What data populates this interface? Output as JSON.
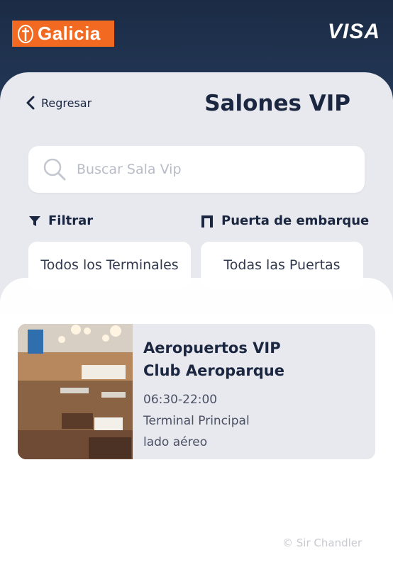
{
  "brand": {
    "bank_name": "Galicia",
    "card_network": "VISA",
    "bank_color": "#f26a21",
    "header_color": "#1b2b45"
  },
  "nav": {
    "back_label": "Regresar",
    "page_title": "Salones VIP"
  },
  "search": {
    "placeholder": "Buscar Sala Vip",
    "value": ""
  },
  "filters": {
    "terminal": {
      "label": "Filtrar",
      "icon": "filter-icon",
      "selected": "Todos los Terminales"
    },
    "gate": {
      "label": "Puerta de embarque",
      "icon": "gate-icon",
      "selected": "Todas las Puertas"
    }
  },
  "lounges": [
    {
      "name_line1": "Aeropuertos VIP",
      "name_line2": "Club Aeroparque",
      "hours": "06:30-22:00",
      "terminal": "Terminal Principal",
      "side": "lado aéreo"
    }
  ],
  "watermark": "© Sir Chandler"
}
